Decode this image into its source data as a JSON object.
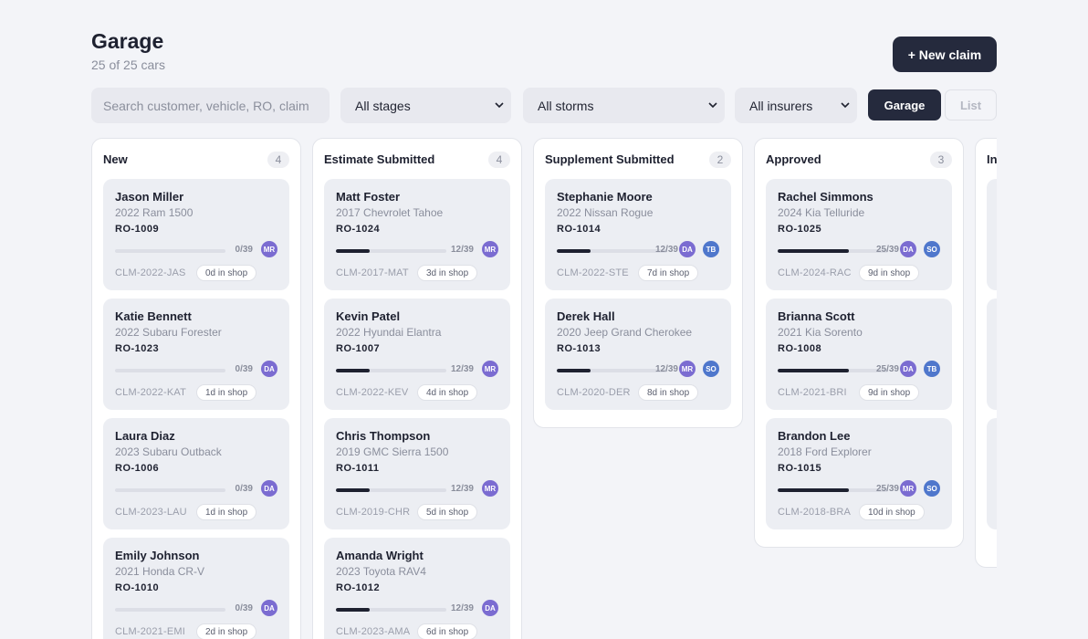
{
  "header": {
    "title": "Garage",
    "subtitle": "25 of 25 cars",
    "new_claim_label": "+ New claim"
  },
  "toolbar": {
    "search_placeholder": "Search customer, vehicle, RO, claim",
    "stage_filter": "All stages",
    "storm_filter": "All storms",
    "insurer_filter": "All insurers",
    "view_garage": "Garage",
    "view_list": "List"
  },
  "colors": {
    "primary": "#252a3d",
    "avatar_purple": "#7b6cd1",
    "avatar_blue": "#4f77cc"
  },
  "columns": [
    {
      "title": "New",
      "count": "4",
      "cards": [
        {
          "name": "Jason Miller",
          "vehicle": "2022 Ram 1500",
          "ro": "RO-1009",
          "progress": "0/39",
          "fraction": 0,
          "claim": "CLM-2022-JAS",
          "days": "0d in shop",
          "avatars": [
            {
              "initials": "MR",
              "color": "#7b6cd1"
            }
          ]
        },
        {
          "name": "Katie Bennett",
          "vehicle": "2022 Subaru Forester",
          "ro": "RO-1023",
          "progress": "0/39",
          "fraction": 0,
          "claim": "CLM-2022-KAT",
          "days": "1d in shop",
          "avatars": [
            {
              "initials": "DA",
              "color": "#7b6cd1"
            }
          ]
        },
        {
          "name": "Laura Diaz",
          "vehicle": "2023 Subaru Outback",
          "ro": "RO-1006",
          "progress": "0/39",
          "fraction": 0,
          "claim": "CLM-2023-LAU",
          "days": "1d in shop",
          "avatars": [
            {
              "initials": "DA",
              "color": "#7b6cd1"
            }
          ]
        },
        {
          "name": "Emily Johnson",
          "vehicle": "2021 Honda CR-V",
          "ro": "RO-1010",
          "progress": "0/39",
          "fraction": 0,
          "claim": "CLM-2021-EMI",
          "days": "2d in shop",
          "avatars": [
            {
              "initials": "DA",
              "color": "#7b6cd1"
            }
          ]
        }
      ]
    },
    {
      "title": "Estimate Submitted",
      "count": "4",
      "cards": [
        {
          "name": "Matt Foster",
          "vehicle": "2017 Chevrolet Tahoe",
          "ro": "RO-1024",
          "progress": "12/39",
          "fraction": 0.3077,
          "claim": "CLM-2017-MAT",
          "days": "3d in shop",
          "avatars": [
            {
              "initials": "MR",
              "color": "#7b6cd1"
            }
          ]
        },
        {
          "name": "Kevin Patel",
          "vehicle": "2022 Hyundai Elantra",
          "ro": "RO-1007",
          "progress": "12/39",
          "fraction": 0.3077,
          "claim": "CLM-2022-KEV",
          "days": "4d in shop",
          "avatars": [
            {
              "initials": "MR",
              "color": "#7b6cd1"
            }
          ]
        },
        {
          "name": "Chris Thompson",
          "vehicle": "2019 GMC Sierra 1500",
          "ro": "RO-1011",
          "progress": "12/39",
          "fraction": 0.3077,
          "claim": "CLM-2019-CHR",
          "days": "5d in shop",
          "avatars": [
            {
              "initials": "MR",
              "color": "#7b6cd1"
            }
          ]
        },
        {
          "name": "Amanda Wright",
          "vehicle": "2023 Toyota RAV4",
          "ro": "RO-1012",
          "progress": "12/39",
          "fraction": 0.3077,
          "claim": "CLM-2023-AMA",
          "days": "6d in shop",
          "avatars": [
            {
              "initials": "DA",
              "color": "#7b6cd1"
            }
          ]
        }
      ]
    },
    {
      "title": "Supplement Submitted",
      "count": "2",
      "cards": [
        {
          "name": "Stephanie Moore",
          "vehicle": "2022 Nissan Rogue",
          "ro": "RO-1014",
          "progress": "12/39",
          "fraction": 0.3077,
          "claim": "CLM-2022-STE",
          "days": "7d in shop",
          "avatars": [
            {
              "initials": "DA",
              "color": "#7b6cd1"
            },
            {
              "initials": "TB",
              "color": "#4f77cc"
            }
          ]
        },
        {
          "name": "Derek Hall",
          "vehicle": "2020 Jeep Grand Cherokee",
          "ro": "RO-1013",
          "progress": "12/39",
          "fraction": 0.3077,
          "claim": "CLM-2020-DER",
          "days": "8d in shop",
          "avatars": [
            {
              "initials": "MR",
              "color": "#7b6cd1"
            },
            {
              "initials": "SO",
              "color": "#4f77cc"
            }
          ]
        }
      ]
    },
    {
      "title": "Approved",
      "count": "3",
      "cards": [
        {
          "name": "Rachel Simmons",
          "vehicle": "2024 Kia Telluride",
          "ro": "RO-1025",
          "progress": "25/39",
          "fraction": 0.641,
          "claim": "CLM-2024-RAC",
          "days": "9d in shop",
          "avatars": [
            {
              "initials": "DA",
              "color": "#7b6cd1"
            },
            {
              "initials": "SO",
              "color": "#4f77cc"
            }
          ]
        },
        {
          "name": "Brianna Scott",
          "vehicle": "2021 Kia Sorento",
          "ro": "RO-1008",
          "progress": "25/39",
          "fraction": 0.641,
          "claim": "CLM-2021-BRI",
          "days": "9d in shop",
          "avatars": [
            {
              "initials": "DA",
              "color": "#7b6cd1"
            },
            {
              "initials": "TB",
              "color": "#4f77cc"
            }
          ]
        },
        {
          "name": "Brandon Lee",
          "vehicle": "2018 Ford Explorer",
          "ro": "RO-1015",
          "progress": "25/39",
          "fraction": 0.641,
          "claim": "CLM-2018-BRA",
          "days": "10d in shop",
          "avatars": [
            {
              "initials": "MR",
              "color": "#7b6cd1"
            },
            {
              "initials": "SO",
              "color": "#4f77cc"
            }
          ]
        }
      ]
    },
    {
      "title": "In",
      "count": "",
      "cards": [
        {
          "name": "",
          "vehicle": "",
          "ro": "",
          "progress": "",
          "fraction": 0,
          "claim": "",
          "days": "",
          "avatars": []
        },
        {
          "name": "",
          "vehicle": "",
          "ro": "",
          "progress": "",
          "fraction": 0,
          "claim": "",
          "days": "",
          "avatars": []
        },
        {
          "name": "",
          "vehicle": "",
          "ro": "",
          "progress": "",
          "fraction": 0,
          "claim": "",
          "days": "",
          "avatars": []
        }
      ]
    }
  ]
}
